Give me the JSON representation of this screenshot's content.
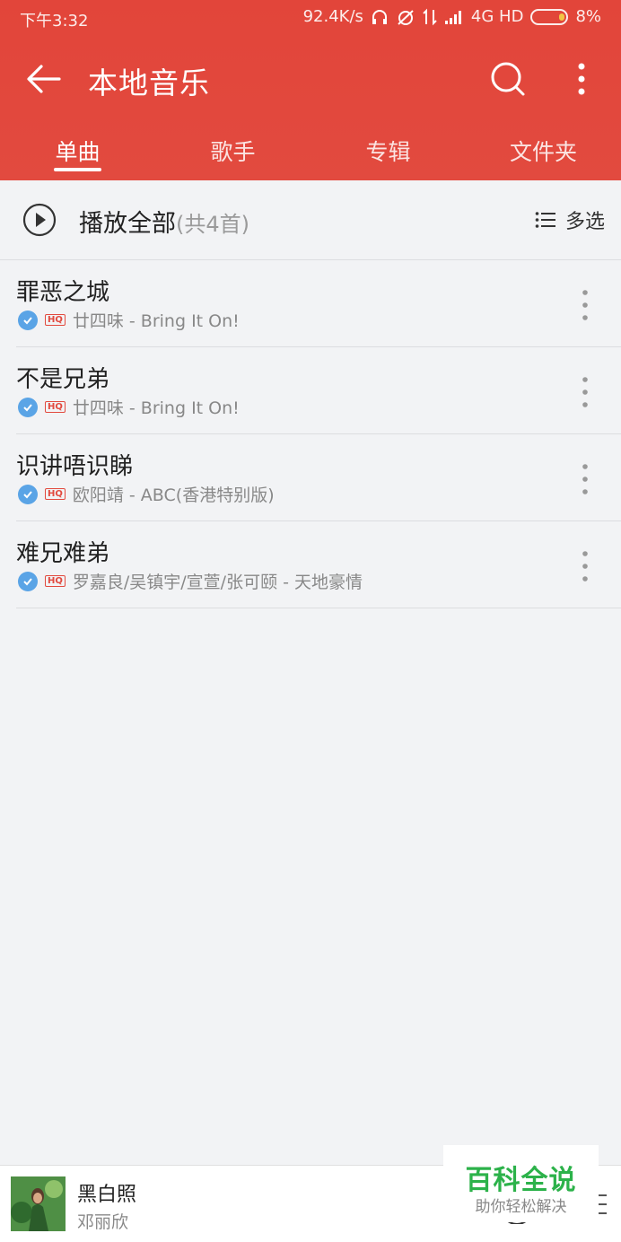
{
  "status_bar": {
    "time": "下午3:32",
    "speed": "92.4K/s",
    "network": "4G HD",
    "battery": "8%"
  },
  "app_bar": {
    "title": "本地音乐",
    "back_icon": "arrow-left-icon",
    "search_icon": "search-icon",
    "more_icon": "more-vertical-icon"
  },
  "tabs": [
    {
      "label": "单曲",
      "active": true
    },
    {
      "label": "歌手",
      "active": false
    },
    {
      "label": "专辑",
      "active": false
    },
    {
      "label": "文件夹",
      "active": false
    }
  ],
  "play_all": {
    "label": "播放全部",
    "count": "(共4首)",
    "multiselect_label": "多选"
  },
  "songs": [
    {
      "title": "罪恶之城",
      "meta": "廿四味 - Bring It On!"
    },
    {
      "title": "不是兄弟",
      "meta": "廿四味 - Bring It On!"
    },
    {
      "title": "识讲唔识睇",
      "meta": "欧阳靖 - ABC(香港特别版)"
    },
    {
      "title": "难兄难弟",
      "meta": "罗嘉良/吴镇宇/宣萱/张可颐 - 天地豪情"
    }
  ],
  "badge": {
    "hq": "HQ"
  },
  "player": {
    "title": "黑白照",
    "artist": "邓丽欣"
  },
  "watermark": {
    "title": "百科全说",
    "subtitle": "助你轻松解决"
  },
  "colors": {
    "accent": "#e24a3f",
    "check": "#5aa4e6",
    "watermark": "#2cb24a"
  }
}
